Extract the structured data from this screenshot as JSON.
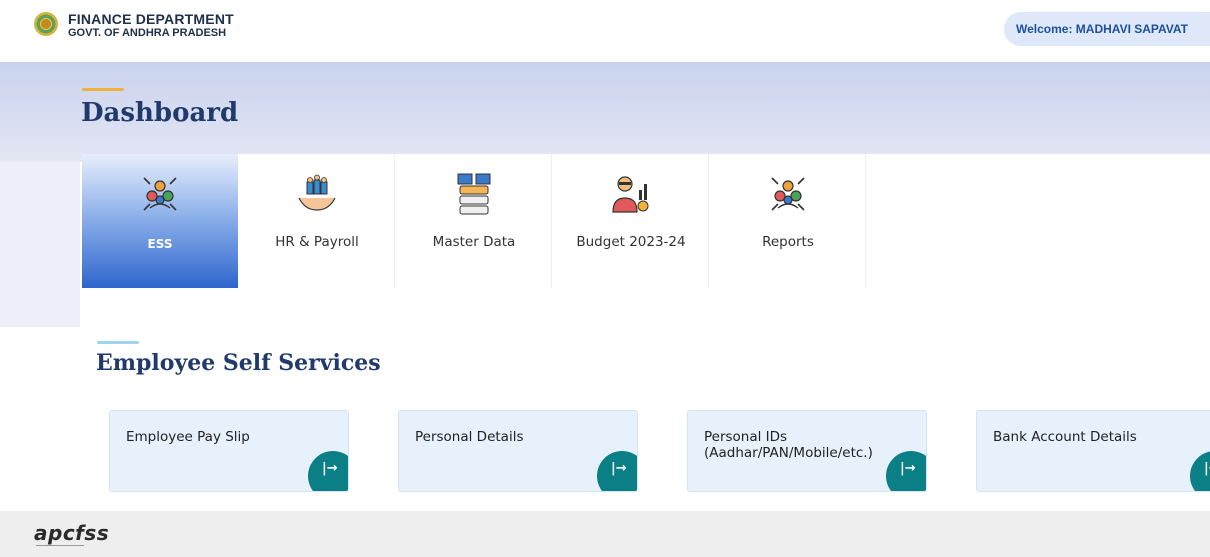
{
  "header": {
    "dept_title": "FINANCE DEPARTMENT",
    "dept_subtitle": "GOVT. OF ANDHRA PRADESH",
    "welcome": "Welcome: MADHAVI SAPAVAT"
  },
  "dashboard": {
    "title": "Dashboard",
    "tiles": [
      {
        "label": "ESS",
        "icon": "network-people-icon",
        "active": true
      },
      {
        "label": "HR & Payroll",
        "icon": "team-hands-icon",
        "active": false
      },
      {
        "label": "Master Data",
        "icon": "database-servers-icon",
        "active": false
      },
      {
        "label": "Budget 2023-24",
        "icon": "accountant-chart-icon",
        "active": false
      },
      {
        "label": "Reports",
        "icon": "network-people-icon",
        "active": false
      }
    ]
  },
  "section": {
    "title": "Employee Self Services",
    "cards": [
      {
        "label": "Employee Pay Slip"
      },
      {
        "label": "Personal Details"
      },
      {
        "label": "Personal IDs (Aadhar/PAN/Mobile/etc.)"
      },
      {
        "label": "Bank Account Details"
      }
    ],
    "arrow_icon": "arrow-right-bar-icon",
    "arrow_glyph": "|→"
  },
  "footer": {
    "logo_text": "apcfss"
  },
  "colors": {
    "primary_blue": "#2f66cd",
    "title_navy": "#1f3a6b",
    "teal": "#0a7f86",
    "accent_orange": "#f2b23a"
  }
}
